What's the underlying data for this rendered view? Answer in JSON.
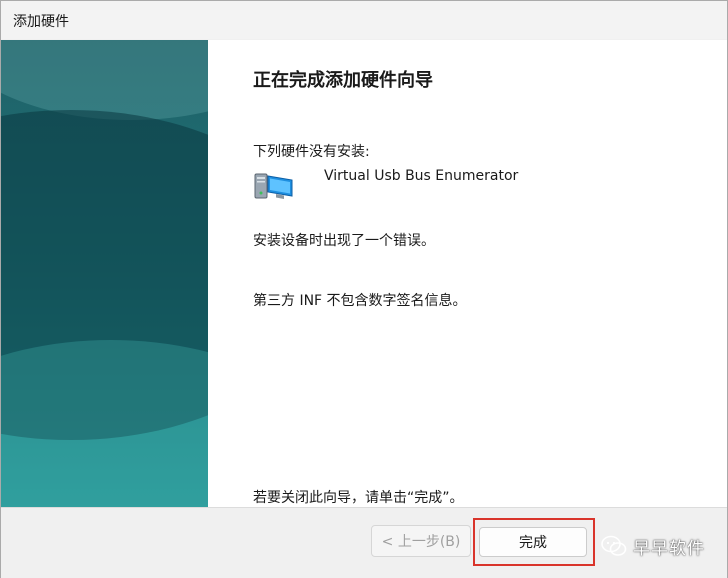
{
  "window": {
    "title": "添加硬件"
  },
  "page": {
    "heading": "正在完成添加硬件向导",
    "intro": "下列硬件没有安装:",
    "device_name": "Virtual Usb Bus Enumerator",
    "device_icon": "computer-monitor-icon",
    "error_message": "安装设备时出现了一个错误。",
    "error_detail": "第三方 INF 不包含数字签名信息。",
    "finish_hint": "若要关闭此向导，请单击“完成”。"
  },
  "buttons": {
    "back": "< 上一步(B)",
    "finish": "完成"
  },
  "watermark": {
    "text": "早早软件"
  },
  "colors": {
    "side_panel": "#1e7478",
    "highlight": "#d9342b"
  }
}
